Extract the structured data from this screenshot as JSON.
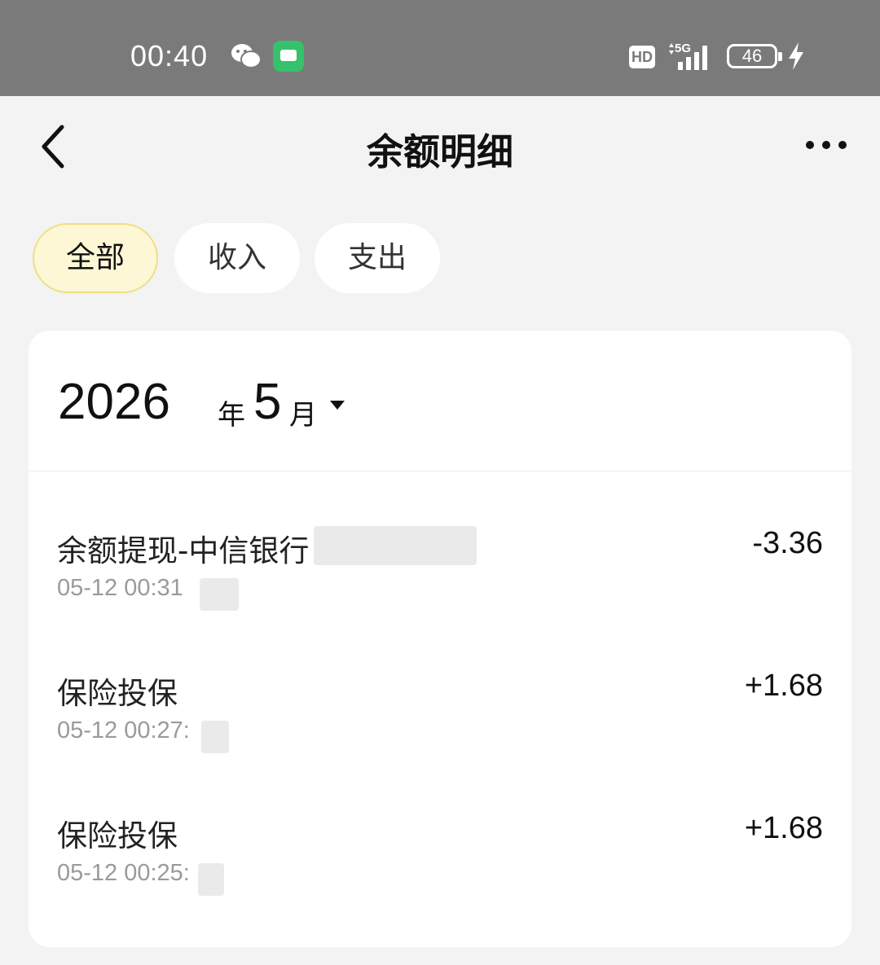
{
  "status_bar": {
    "time": "00:40",
    "hd": "HD",
    "battery": "46"
  },
  "header": {
    "title": "余额明细"
  },
  "tabs": [
    {
      "label": "全部",
      "active": true
    },
    {
      "label": "收入",
      "active": false
    },
    {
      "label": "支出",
      "active": false
    }
  ],
  "month_selector": {
    "year": "2026",
    "year_unit": "年",
    "month": "5",
    "month_unit": "月"
  },
  "transactions": [
    {
      "title": "余额提现-中信银行",
      "time": "05-12 00:31",
      "amount": "-3.36"
    },
    {
      "title": "保险投保",
      "time": "05-12 00:27:",
      "amount": "+1.68"
    },
    {
      "title": "保险投保",
      "time": "05-12 00:25:",
      "amount": "+1.68"
    }
  ],
  "colors": {
    "status_bar_bg": "#7a7a7a",
    "page_bg": "#f3f3f3",
    "active_tab_bg": "#fdf7d6",
    "active_tab_border": "#efdf84",
    "wechat_green": "#35c26a"
  }
}
